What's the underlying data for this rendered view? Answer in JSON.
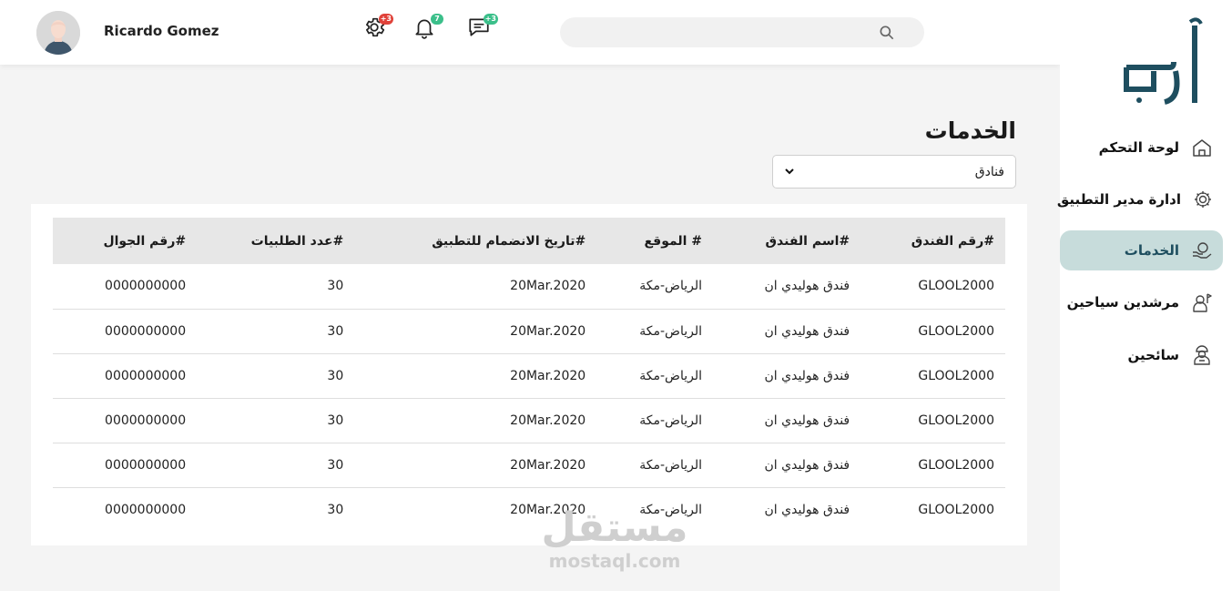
{
  "brand": {
    "logo_text": "أرحب"
  },
  "user": {
    "name": "Ricardo Gomez"
  },
  "topbar": {
    "settings_badge": "+3",
    "notifications_badge": "7",
    "messages_badge": "+3",
    "search_placeholder": "",
    "colors": {
      "settings_badge": "#e0423a",
      "notifications_badge": "#3bbf8a",
      "messages_badge": "#3bbf8a"
    }
  },
  "sidebar": {
    "items": [
      {
        "label": "لوحة التحكم",
        "icon": "home-icon",
        "active": false
      },
      {
        "label": "ادارة مدير التطبيق",
        "icon": "admin-gear-icon",
        "active": false
      },
      {
        "label": "الخدمات",
        "icon": "services-hand-icon",
        "active": true
      },
      {
        "label": "مرشدين سياحين",
        "icon": "tour-guide-icon",
        "active": false
      },
      {
        "label": "سائحين",
        "icon": "tourist-icon",
        "active": false
      }
    ],
    "active_color": "#c7dcdb"
  },
  "main": {
    "title": "الخدمات",
    "filter": {
      "selected": "فنادق"
    }
  },
  "table": {
    "headers": [
      "#رقم الفندق",
      "#اسم الفندق",
      "# الموقع",
      "#تاريخ الانضمام للتطبيق",
      "#عدد الطلبيات",
      "#رقم الجوال"
    ],
    "rows": [
      [
        "GLOOL2000",
        "فندق هوليدي ان",
        "الرياض-مكة",
        "20Mar.2020",
        "30",
        "0000000000"
      ],
      [
        "GLOOL2000",
        "فندق هوليدي ان",
        "الرياض-مكة",
        "20Mar.2020",
        "30",
        "0000000000"
      ],
      [
        "GLOOL2000",
        "فندق هوليدي ان",
        "الرياض-مكة",
        "20Mar.2020",
        "30",
        "0000000000"
      ],
      [
        "GLOOL2000",
        "فندق هوليدي ان",
        "الرياض-مكة",
        "20Mar.2020",
        "30",
        "0000000000"
      ],
      [
        "GLOOL2000",
        "فندق هوليدي ان",
        "الرياض-مكة",
        "20Mar.2020",
        "30",
        "0000000000"
      ],
      [
        "GLOOL2000",
        "فندق هوليدي ان",
        "الرياض-مكة",
        "20Mar.2020",
        "30",
        "0000000000"
      ]
    ]
  },
  "watermark": {
    "arabic": "مستقل",
    "latin": "mostaql.com"
  }
}
